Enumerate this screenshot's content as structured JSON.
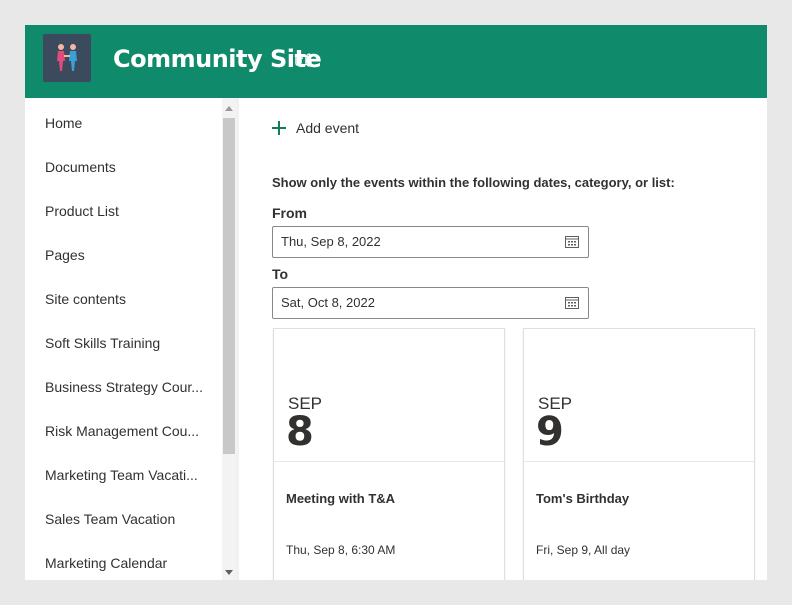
{
  "header": {
    "site_title": "Community Site",
    "logo_icon": "people-logo-icon",
    "teams_icon": "teams-icon",
    "bg_color": "#0f8a6a"
  },
  "sidebar": {
    "items": [
      {
        "label": "Home"
      },
      {
        "label": "Documents"
      },
      {
        "label": "Product List"
      },
      {
        "label": "Pages"
      },
      {
        "label": "Site contents"
      },
      {
        "label": "Soft Skills Training"
      },
      {
        "label": "Business Strategy Cour..."
      },
      {
        "label": "Risk Management Cou..."
      },
      {
        "label": "Marketing Team Vacati..."
      },
      {
        "label": "Sales Team Vacation"
      },
      {
        "label": "Marketing Calendar"
      }
    ]
  },
  "main": {
    "add_event_label": "Add event",
    "filter_text": "Show only the events within the following dates, category, or list:",
    "from_label": "From",
    "from_value": "Thu, Sep 8, 2022",
    "to_label": "To",
    "to_value": "Sat, Oct 8, 2022",
    "events": [
      {
        "month": "SEP",
        "day": "8",
        "title": "Meeting with T&A",
        "when": "Thu, Sep 8, 6:30 AM"
      },
      {
        "month": "SEP",
        "day": "9",
        "title": "Tom's Birthday",
        "when": "Fri, Sep 9, All day"
      }
    ]
  }
}
